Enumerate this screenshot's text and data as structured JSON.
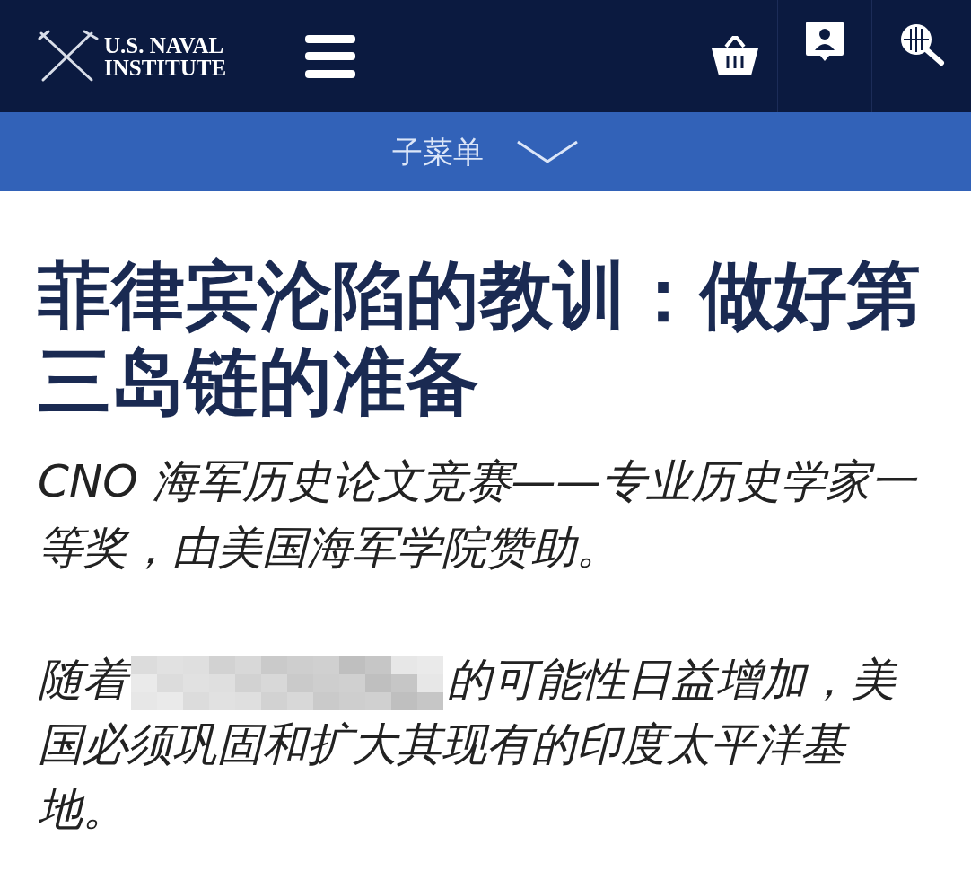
{
  "header": {
    "logo_lines": [
      "U.S. NAVAL",
      "INSTITUTE"
    ]
  },
  "submenu": {
    "label": "子菜单",
    "expanded": false
  },
  "article": {
    "title": "菲律宾沦陷的教训：做好第三岛链的准备",
    "subtitle": "CNO 海军历史论文竞赛——专业历史学家一等奖，由美国海军学院赞助。",
    "paragraph": {
      "before": "随着",
      "redacted": true,
      "after": "的可能性日益增加，美国必须巩固和扩大其现有的印度太平洋基地。"
    }
  }
}
